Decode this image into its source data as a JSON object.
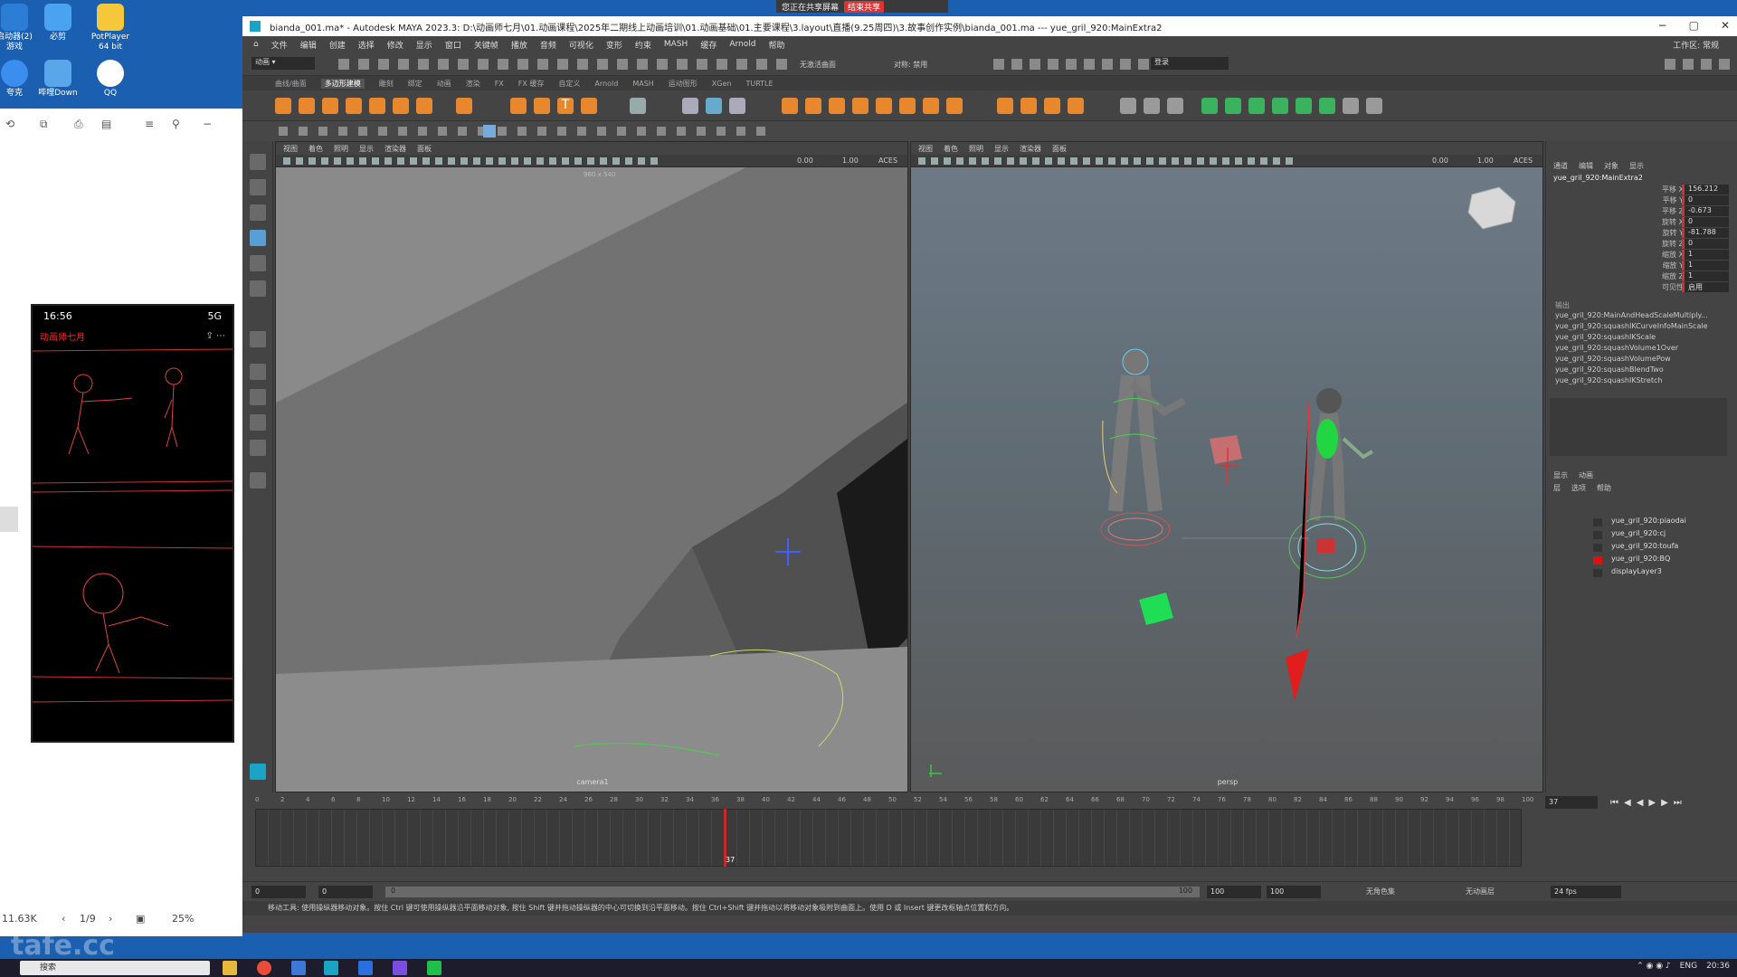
{
  "desktop": {
    "icons": [
      {
        "label": "启动器(2)\n游戏"
      },
      {
        "label": "必剪"
      },
      {
        "label": "PotPlayer\n64 bit"
      },
      {
        "label": "夸克"
      },
      {
        "label": "哔哩Down"
      },
      {
        "label": "QQ"
      }
    ]
  },
  "share_banner": {
    "text": "您正在共享屏幕",
    "stop": "结束共享"
  },
  "left_panel": {
    "page_indicator": "1/9",
    "zoom": "25%",
    "filesize": "11.63K",
    "phone": {
      "time": "16:56",
      "signal": "5G",
      "back_label": "动画师七月"
    }
  },
  "maya": {
    "title": "bianda_001.ma* - Autodesk MAYA 2023.3: D:\\动画师七月\\01.动画课程\\2025年二期线上动画培训\\01.动画基础\\01.主要课程\\3.layout\\直播(9.25周四)\\3.故事创作实例\\bianda_001.ma  ---  yue_gril_920:MainExtra2",
    "menus": [
      "文件",
      "编辑",
      "创建",
      "选择",
      "修改",
      "显示",
      "窗口",
      "关键帧",
      "播放",
      "音频",
      "可视化",
      "变形",
      "约束",
      "MASH",
      "缓存",
      "Arnold",
      "帮助"
    ],
    "workspace": "工作区: 常规",
    "shelf_tabs": [
      "曲线/曲面",
      "多边形建模",
      "雕刻",
      "绑定",
      "动画",
      "渲染",
      "FX",
      "FX 缓存",
      "自定义",
      "Arnold",
      "MASH",
      "运动图形",
      "XGen",
      "TURTLE"
    ],
    "shelf_active_tab": "多边形建模",
    "login": "登录",
    "no_live": "无激活曲面",
    "symmetry": "对称: 禁用",
    "viewport_menus": [
      "视图",
      "着色",
      "照明",
      "显示",
      "渲染器",
      "面板"
    ],
    "viewport_left": {
      "label": "camera1",
      "res": "960 x 540",
      "num1": "0.00",
      "num2": "1.00",
      "aces": "ACES"
    },
    "viewport_right": {
      "label": "persp",
      "num1": "0.00",
      "num2": "1.00",
      "aces": "ACES"
    },
    "channel_box": {
      "tabs": [
        "通道",
        "编辑",
        "对象",
        "显示"
      ],
      "object": "yue_gril_920:MainExtra2",
      "channels": [
        {
          "name": "平移 X",
          "value": "156.212"
        },
        {
          "name": "平移 Y",
          "value": "0"
        },
        {
          "name": "平移 Z",
          "value": "-0.673"
        },
        {
          "name": "旋转 X",
          "value": "0"
        },
        {
          "name": "旋转 Y",
          "value": "-81.788"
        },
        {
          "name": "旋转 Z",
          "value": "0"
        },
        {
          "name": "缩放 X",
          "value": "1"
        },
        {
          "name": "缩放 Y",
          "value": "1"
        },
        {
          "name": "缩放 Z",
          "value": "1"
        },
        {
          "name": "可见性",
          "value": "启用"
        }
      ],
      "inputs_label": "输出",
      "inputs": [
        "yue_gril_920:MainAndHeadScaleMultiply...",
        "yue_gril_920:squashIKCurveInfoMainScale",
        "yue_gril_920:squashIKScale",
        "yue_gril_920:squashVolume1Over",
        "yue_gril_920:squashVolumePow",
        "yue_gril_920:squashBlendTwo",
        "yue_gril_920:squashIKStretch"
      ]
    },
    "layer_editor": {
      "tabs": [
        "显示",
        "动画"
      ],
      "menus": [
        "层",
        "选项",
        "帮助"
      ],
      "layers": [
        {
          "name": "yue_gril_920:piaodai",
          "color": ""
        },
        {
          "name": "yue_gril_920:cj",
          "color": ""
        },
        {
          "name": "yue_gril_920:toufa",
          "color": ""
        },
        {
          "name": "yue_gril_920:BQ",
          "color": "#e01010"
        },
        {
          "name": "displayLayer3",
          "color": ""
        }
      ]
    },
    "timeline": {
      "ticks": [
        "0",
        "2",
        "4",
        "6",
        "8",
        "10",
        "12",
        "14",
        "16",
        "18",
        "20",
        "22",
        "24",
        "26",
        "28",
        "30",
        "32",
        "34",
        "36",
        "38",
        "40",
        "42",
        "44",
        "46",
        "48",
        "50",
        "52",
        "54",
        "56",
        "58",
        "60",
        "62",
        "64",
        "66",
        "68",
        "70",
        "72",
        "74",
        "76",
        "78",
        "80",
        "82",
        "84",
        "86",
        "88",
        "90",
        "92",
        "94",
        "96",
        "98",
        "100"
      ],
      "start": 0,
      "end": 100,
      "current_frame": "37",
      "current_frame_field": "37"
    },
    "range": {
      "start": "0",
      "start2": "0",
      "range_start": "0",
      "range_end": "100",
      "end": "100",
      "end2": "100",
      "char_set": "无角色集",
      "anim_layer": "无动画层",
      "fps": "24 fps"
    },
    "help_line": "移动工具: 使用操纵器移动对象。按住 Ctrl 键可使用操纵器沿平面移动对象, 按住 Shift 键并拖动操纵器的中心可切换到沿平面移动。按住 Ctrl+Shift 键并拖动以将移动对象吸附到曲面上。使用 D 或 Insert 键更改枢轴点位置和方向。"
  },
  "taskbar": {
    "search": "搜索",
    "lang": "ENG",
    "time": "20:36"
  },
  "watermark": "tafe.cc",
  "colors": {
    "accent": "#2f8ad8",
    "viewport_bg": "#5b5b5b",
    "desktop": "#1b5fb0"
  }
}
